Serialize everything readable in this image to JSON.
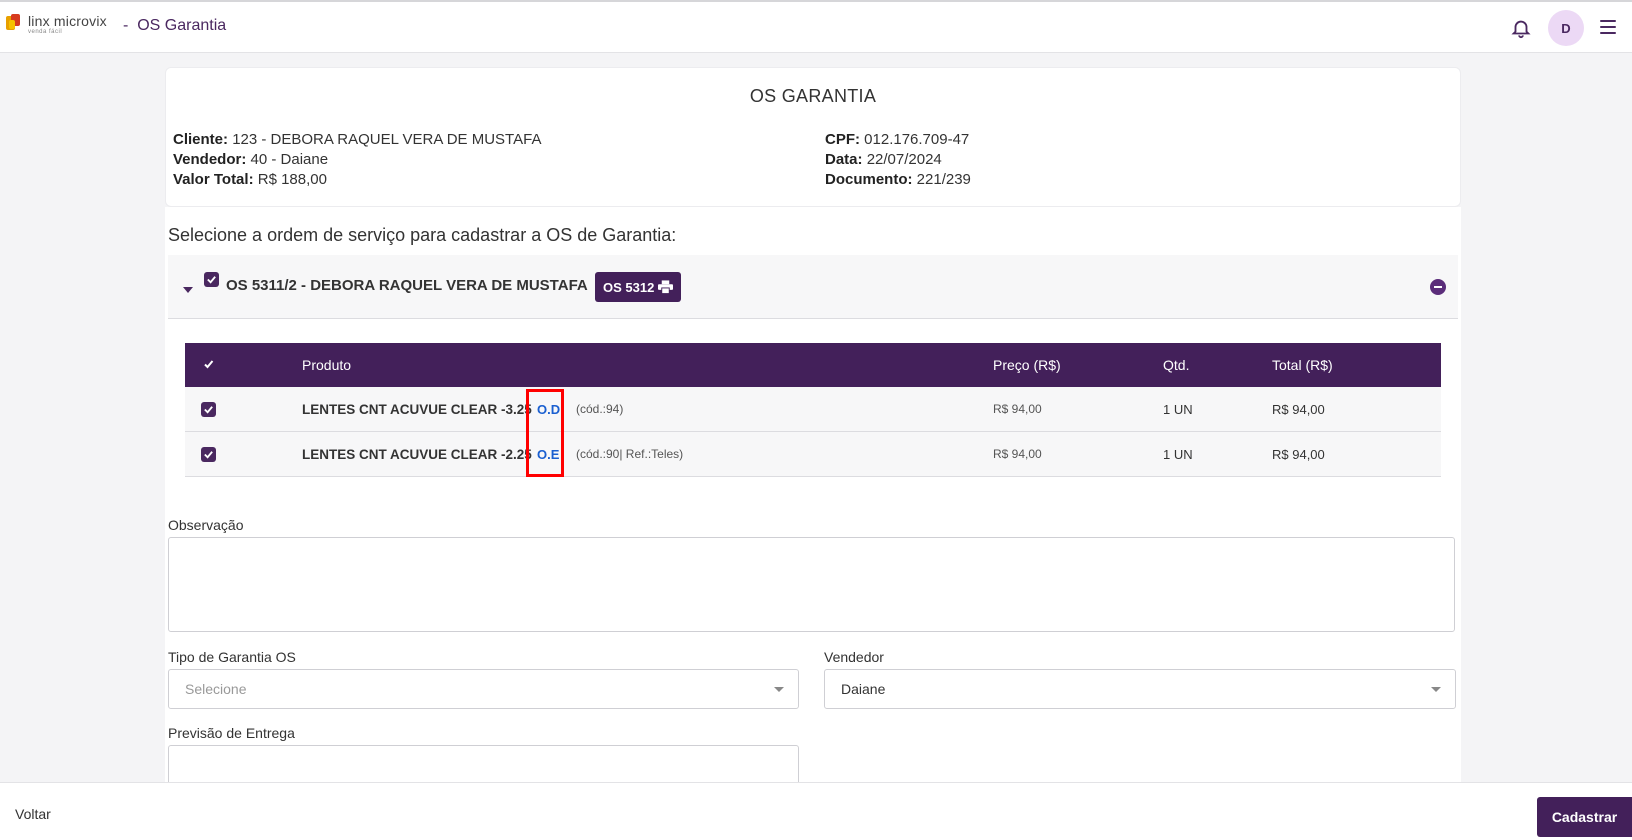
{
  "header": {
    "brand": "linx microvix",
    "brand_tagline": "venda fácil",
    "separator": "-",
    "page_title": "OS Garantia",
    "avatar_initial": "D"
  },
  "summary": {
    "title": "OS GARANTIA",
    "left": [
      {
        "label": "Cliente:",
        "value": "123 - DEBORA RAQUEL VERA DE MUSTAFA"
      },
      {
        "label": "Vendedor:",
        "value": "40 - Daiane"
      },
      {
        "label": "Valor Total:",
        "value": "R$ 188,00"
      }
    ],
    "right": [
      {
        "label": "CPF:",
        "value": "012.176.709-47"
      },
      {
        "label": "Data:",
        "value": "22/07/2024"
      },
      {
        "label": "Documento:",
        "value": "221/239"
      }
    ]
  },
  "selection": {
    "prompt": "Selecione a ordem de serviço para cadastrar a OS de Garantia:",
    "os_name": "OS 5311/2 - DEBORA RAQUEL VERA DE MUSTAFA",
    "os_badge": "OS 5312"
  },
  "table": {
    "headers": {
      "produto": "Produto",
      "preco": "Preço (R$)",
      "qtd": "Qtd.",
      "total": "Total (R$)"
    },
    "rows": [
      {
        "produto": "LENTES CNT ACUVUE CLEAR -3.25",
        "eye": "O.D",
        "codigo": "(cód.:94)",
        "preco": "R$ 94,00",
        "qtd": "1 UN",
        "total": "R$ 94,00"
      },
      {
        "produto": "LENTES CNT ACUVUE CLEAR -2.25",
        "eye": "O.E",
        "codigo": "(cód.:90| Ref.:Teles)",
        "preco": "R$ 94,00",
        "qtd": "1 UN",
        "total": "R$ 94,00"
      }
    ]
  },
  "form": {
    "observacao_label": "Observação",
    "observacao_value": "",
    "tipo_label": "Tipo de Garantia OS",
    "tipo_placeholder": "Selecione",
    "vendedor_label": "Vendedor",
    "vendedor_value": "Daiane",
    "previsao_label": "Previsão de Entrega",
    "previsao_value": ""
  },
  "footer": {
    "back_label": "Voltar",
    "submit_label": "Cadastrar"
  },
  "colors": {
    "brand_purple": "#43205a",
    "highlight_red": "#ff0000",
    "eye_blue": "#1a5fd0"
  }
}
